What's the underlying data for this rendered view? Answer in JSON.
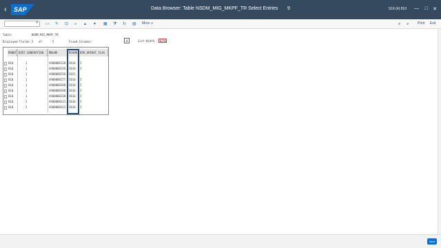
{
  "titlebar": {
    "back_glyph": "‹",
    "logo_text": "SAP",
    "title": "Data Browser: Table NSDM_MIG_MKPF_TR Select Entries",
    "count": "9",
    "system": "S16 (4) 810",
    "minimize": "—",
    "restore": "□",
    "close": "✕"
  },
  "toolbar": {
    "more_label": "More ∨",
    "print_label": "Print",
    "exit_label": "Exit"
  },
  "meta": {
    "table_label": "Table:",
    "table_value": "NSDM_MIG_MKPF_TR",
    "displayed_label": "Displayed Fields:",
    "displayed_value": "5",
    "of_label": "of",
    "of_value": "5",
    "fixed_label": "Fixed Columns:",
    "fixed_value": "4",
    "list_width_label": "List Width",
    "list_width_value": "0250"
  },
  "grid": {
    "columns": [
      "MANDT",
      "BZDT_GENERATION",
      "MBLNR",
      "MJAHR",
      "ERR_OPERAT_FLAG"
    ],
    "rows": [
      [
        "810",
        "1",
        "4900000138",
        "2016",
        "I"
      ],
      [
        "810",
        "1",
        "4900000236",
        "2016",
        "I"
      ],
      [
        "810",
        "1",
        "4900000236",
        "2021",
        ""
      ],
      [
        "810",
        "1",
        "4900000277",
        "2016",
        "I"
      ],
      [
        "810",
        "1",
        "4900000288",
        "2016",
        "I"
      ],
      [
        "810",
        "1",
        "4900000288",
        "2016",
        "I"
      ],
      [
        "810",
        "1",
        "4900000238",
        "2016",
        "I"
      ],
      [
        "810",
        "2",
        "4900000233",
        "2016",
        "I"
      ],
      [
        "810",
        "2",
        "4900000233",
        "2016",
        "I"
      ]
    ]
  },
  "footer": {
    "next_label": "Next"
  }
}
